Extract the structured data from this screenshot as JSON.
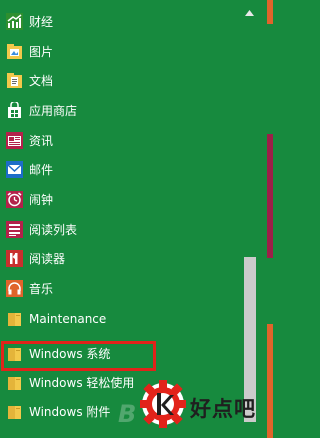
{
  "apps": [
    {
      "label": "财经",
      "icon": "finance-chart-icon"
    },
    {
      "label": "图片",
      "icon": "photos-icon"
    },
    {
      "label": "文档",
      "icon": "documents-icon"
    },
    {
      "label": "应用商店",
      "icon": "store-bag-icon"
    },
    {
      "label": "资讯",
      "icon": "news-icon"
    },
    {
      "label": "邮件",
      "icon": "mail-envelope-icon"
    },
    {
      "label": "闹钟",
      "icon": "alarm-clock-icon"
    },
    {
      "label": "阅读列表",
      "icon": "reading-list-icon"
    },
    {
      "label": "阅读器",
      "icon": "reader-icon"
    },
    {
      "label": "音乐",
      "icon": "music-headphones-icon"
    },
    {
      "label": "Maintenance",
      "icon": "folder-icon"
    },
    {
      "label": "Windows 系统",
      "icon": "folder-icon"
    },
    {
      "label": "Windows 轻松使用",
      "icon": "folder-icon"
    },
    {
      "label": "Windows 附件",
      "icon": "folder-icon"
    }
  ],
  "scrollbar": {
    "position_fraction": 0.6
  },
  "watermark": {
    "text": "好点吧",
    "letter": "B",
    "logo_icon": "gear-k-logo-icon"
  },
  "colors": {
    "background": "#178a3e",
    "highlight_border": "#e2231a",
    "tile_orange": "#e0642b",
    "tile_maroon": "#9c1f48",
    "scroll_thumb": "#cbcbcb"
  }
}
